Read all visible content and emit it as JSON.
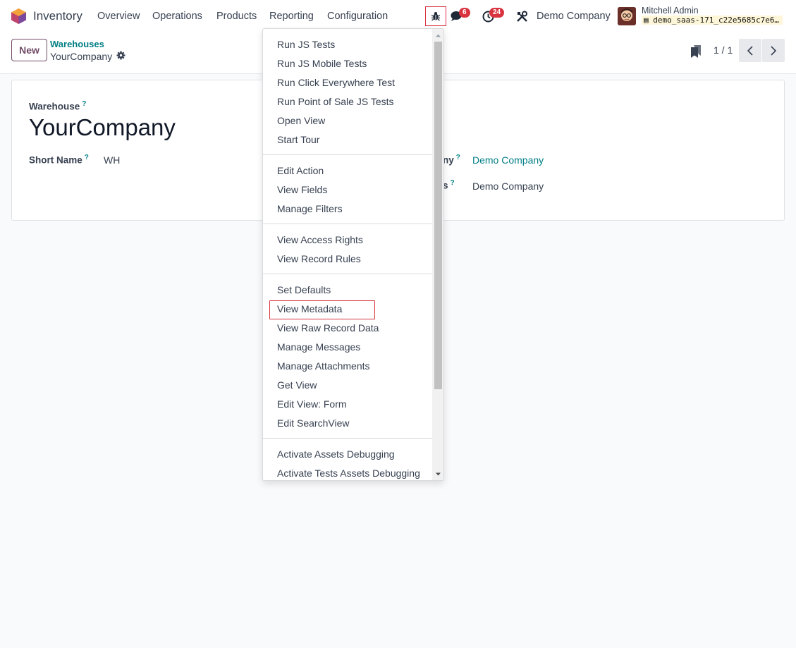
{
  "navbar": {
    "app_name": "Inventory",
    "menu": [
      "Overview",
      "Operations",
      "Products",
      "Reporting",
      "Configuration"
    ],
    "messages_count": "6",
    "activities_count": "24",
    "company": "Demo Company",
    "user_name": "Mitchell Admin",
    "db_name": "demo_saas-171_c22e5685c7e6…"
  },
  "control_panel": {
    "new_label": "New",
    "breadcrumb_parent": "Warehouses",
    "breadcrumb_current": "YourCompany",
    "pager": "1 / 1"
  },
  "form": {
    "warehouse_label": "Warehouse",
    "warehouse_name": "YourCompany",
    "short_name_label": "Short Name",
    "short_name_value": "WH",
    "company_label_tail": "ny",
    "company_value": "Demo Company",
    "address_label_tail": "s",
    "address_value": "Demo Company",
    "help_mark": "?"
  },
  "debug_menu": {
    "groups": [
      [
        "Run JS Tests",
        "Run JS Mobile Tests",
        "Run Click Everywhere Test",
        "Run Point of Sale JS Tests",
        "Open View",
        "Start Tour"
      ],
      [
        "Edit Action",
        "View Fields",
        "Manage Filters"
      ],
      [
        "View Access Rights",
        "View Record Rules"
      ],
      [
        "Set Defaults",
        "View Metadata",
        "View Raw Record Data",
        "Manage Messages",
        "Manage Attachments",
        "Get View",
        "Edit View: Form",
        "Edit SearchView"
      ],
      [
        "Activate Assets Debugging",
        "Activate Tests Assets Debugging"
      ]
    ],
    "highlighted": "View Metadata"
  },
  "colors": {
    "brand": "#714b67",
    "link": "#017e84",
    "badge": "#d9333f"
  }
}
